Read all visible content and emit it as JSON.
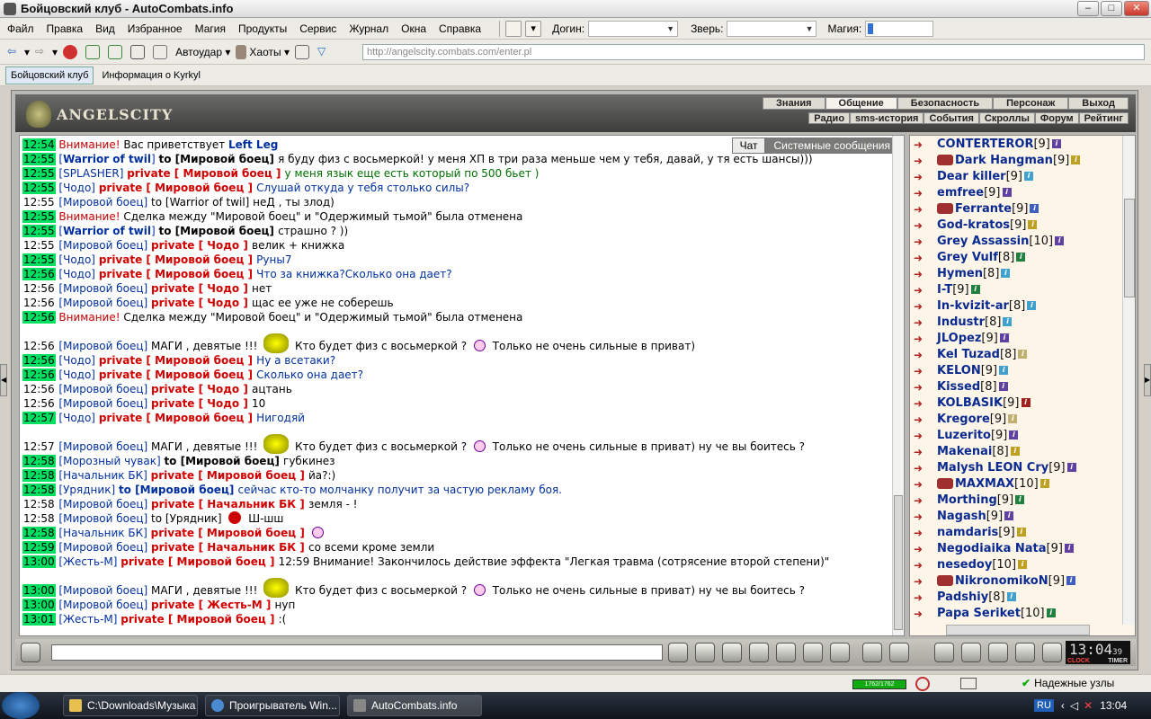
{
  "window": {
    "title": "Бойцовский клуб - AutoCombats.info",
    "btn_min": "–",
    "btn_max": "□",
    "btn_close": "✕"
  },
  "menu": {
    "items": [
      "Файл",
      "Правка",
      "Вид",
      "Избранное",
      "Магия",
      "Продукты",
      "Сервис",
      "Журнал",
      "Окна",
      "Справка"
    ],
    "login_label": "Догин:",
    "beast_label": "Зверь:",
    "magic_label": "Магия:"
  },
  "nav": {
    "autoudar": "Автоудар",
    "haoty": "Хаоты",
    "url": "http://angelscity.combats.com/enter.pl"
  },
  "tabs": [
    "Бойцовский клуб",
    "Информация о Kyrkyl"
  ],
  "game": {
    "logo": "ANGELSCITY",
    "topnav": [
      "Знания",
      "Общение",
      "Безопасность",
      "Персонаж",
      "Выход"
    ],
    "subnav": [
      "Радио",
      "sms-история",
      "События",
      "Скроллы",
      "Форум",
      "Рейтинг"
    ]
  },
  "chat": {
    "tabs": [
      "Чат",
      "Системные сообщения"
    ],
    "lines": [
      {
        "t": "12:54",
        "hl": true,
        "parts": [
          {
            "c": "alert",
            "x": "Внимание! "
          },
          {
            "c": "",
            "x": "Вас приветствует "
          },
          {
            "c": "nick bold",
            "x": "Left Leg"
          }
        ]
      },
      {
        "t": "12:55",
        "hl": true,
        "parts": [
          {
            "c": "nick",
            "x": "["
          },
          {
            "c": "nick bold",
            "x": "Warrior of twil"
          },
          {
            "c": "nick",
            "x": "] "
          },
          {
            "c": "bold",
            "x": "to [Мировой боец] "
          },
          {
            "c": "",
            "x": "я буду физ с восьмеркой! у меня ХП в три раза меньше чем у тебя, давай, у тя есть шансы)))"
          }
        ]
      },
      {
        "t": "12:55",
        "hl": true,
        "parts": [
          {
            "c": "nick",
            "x": "[SPLASHER] "
          },
          {
            "c": "priv",
            "x": "private [ Мировой боец ] "
          },
          {
            "c": "msggreen",
            "x": "у меня язык еще есть который по 500 бьет )"
          }
        ]
      },
      {
        "t": "12:55",
        "hl": true,
        "parts": [
          {
            "c": "nick",
            "x": "[Чодо] "
          },
          {
            "c": "priv",
            "x": "private [ Мировой боец ] "
          },
          {
            "c": "msgblue",
            "x": "Слушай откуда у тебя столько силы?"
          }
        ]
      },
      {
        "t": "12:55",
        "hl": false,
        "parts": [
          {
            "c": "nick",
            "x": "[Мировой боец] "
          },
          {
            "c": "",
            "x": "to [Warrior of twil] неД , ты злод)"
          }
        ]
      },
      {
        "t": "12:55",
        "hl": true,
        "parts": [
          {
            "c": "alert",
            "x": "Внимание! "
          },
          {
            "c": "",
            "x": "Сделка между \"Мировой боец\" и \"Одержимый тьмой\" была отменена"
          }
        ]
      },
      {
        "t": "12:55",
        "hl": true,
        "parts": [
          {
            "c": "nick",
            "x": "["
          },
          {
            "c": "nick bold",
            "x": "Warrior of twil"
          },
          {
            "c": "nick",
            "x": "] "
          },
          {
            "c": "bold",
            "x": "to [Мировой боец] "
          },
          {
            "c": "",
            "x": "страшно ? ))"
          }
        ]
      },
      {
        "t": "12:55",
        "hl": false,
        "parts": [
          {
            "c": "nick",
            "x": "[Мировой боец] "
          },
          {
            "c": "priv",
            "x": "private [ Чодо ] "
          },
          {
            "c": "",
            "x": "велик + книжка"
          }
        ]
      },
      {
        "t": "12:55",
        "hl": true,
        "parts": [
          {
            "c": "nick",
            "x": "[Чодо] "
          },
          {
            "c": "priv",
            "x": "private [ Мировой боец ] "
          },
          {
            "c": "msgblue",
            "x": "Руны7"
          }
        ]
      },
      {
        "t": "12:56",
        "hl": true,
        "parts": [
          {
            "c": "nick",
            "x": "[Чодо] "
          },
          {
            "c": "priv",
            "x": "private [ Мировой боец ] "
          },
          {
            "c": "msgblue",
            "x": "Что за книжка?Сколько она дает?"
          }
        ]
      },
      {
        "t": "12:56",
        "hl": false,
        "parts": [
          {
            "c": "nick",
            "x": "[Мировой боец] "
          },
          {
            "c": "priv",
            "x": "private [ Чодо ] "
          },
          {
            "c": "",
            "x": "нет"
          }
        ]
      },
      {
        "t": "12:56",
        "hl": false,
        "parts": [
          {
            "c": "nick",
            "x": "[Мировой боец] "
          },
          {
            "c": "priv",
            "x": "private [ Чодо ] "
          },
          {
            "c": "",
            "x": "щас ее уже не соберешь"
          }
        ]
      },
      {
        "t": "12:56",
        "hl": true,
        "parts": [
          {
            "c": "alert",
            "x": "Внимание! "
          },
          {
            "c": "",
            "x": "Сделка между \"Мировой боец\" и \"Одержимый тьмой\" была отменена"
          }
        ]
      },
      {
        "t": "12:56",
        "hl": false,
        "gap": true,
        "parts": [
          {
            "c": "nick",
            "x": "[Мировой боец] "
          },
          {
            "c": "",
            "x": "МАГИ , девятые !!! "
          },
          {
            "c": "mage",
            "x": ""
          },
          {
            "c": "",
            "x": " Кто будет физ с восьмеркой ? "
          },
          {
            "c": "smile",
            "x": ""
          },
          {
            "c": "",
            "x": " Только не очень сильные в приват)"
          }
        ]
      },
      {
        "t": "12:56",
        "hl": true,
        "parts": [
          {
            "c": "nick",
            "x": "[Чодо] "
          },
          {
            "c": "priv",
            "x": "private [ Мировой боец ] "
          },
          {
            "c": "msgblue",
            "x": "Ну а всетаки?"
          }
        ]
      },
      {
        "t": "12:56",
        "hl": true,
        "parts": [
          {
            "c": "nick",
            "x": "[Чодо] "
          },
          {
            "c": "priv",
            "x": "private [ Мировой боец ] "
          },
          {
            "c": "msgblue",
            "x": "Сколько она дает?"
          }
        ]
      },
      {
        "t": "12:56",
        "hl": false,
        "parts": [
          {
            "c": "nick",
            "x": "[Мировой боец] "
          },
          {
            "c": "priv",
            "x": "private [ Чодо ] "
          },
          {
            "c": "",
            "x": "ацтань"
          }
        ]
      },
      {
        "t": "12:56",
        "hl": false,
        "parts": [
          {
            "c": "nick",
            "x": "[Мировой боец] "
          },
          {
            "c": "priv",
            "x": "private [ Чодо ] "
          },
          {
            "c": "",
            "x": "10"
          }
        ]
      },
      {
        "t": "12:57",
        "hl": true,
        "parts": [
          {
            "c": "nick",
            "x": "[Чодо] "
          },
          {
            "c": "priv",
            "x": "private [ Мировой боец ] "
          },
          {
            "c": "msgblue",
            "x": "Нигодяй"
          }
        ]
      },
      {
        "t": "12:57",
        "hl": false,
        "gap": true,
        "parts": [
          {
            "c": "nick",
            "x": "[Мировой боец] "
          },
          {
            "c": "",
            "x": "МАГИ , девятые !!! "
          },
          {
            "c": "mage",
            "x": ""
          },
          {
            "c": "",
            "x": " Кто будет физ с восьмеркой ? "
          },
          {
            "c": "smile",
            "x": ""
          },
          {
            "c": "",
            "x": " Только не очень сильные в приват) ну че вы боитесь ?"
          }
        ]
      },
      {
        "t": "12:58",
        "hl": true,
        "parts": [
          {
            "c": "nick",
            "x": "[Морозный чувак] "
          },
          {
            "c": "bold",
            "x": "to [Мировой боец] "
          },
          {
            "c": "",
            "x": "губкинез"
          }
        ]
      },
      {
        "t": "12:58",
        "hl": true,
        "parts": [
          {
            "c": "nick",
            "x": "[Начальник БК] "
          },
          {
            "c": "priv",
            "x": "private [ Мировой боец ] "
          },
          {
            "c": "",
            "x": "йа?:)"
          }
        ]
      },
      {
        "t": "12:58",
        "hl": true,
        "parts": [
          {
            "c": "nick",
            "x": "[Урядник] "
          },
          {
            "c": "nick bold",
            "x": "to [Мировой боец] "
          },
          {
            "c": "msgblue",
            "x": "сейчас кто-то молчанку получит за частую рекламу боя."
          }
        ]
      },
      {
        "t": "12:58",
        "hl": false,
        "parts": [
          {
            "c": "nick",
            "x": "[Мировой боец] "
          },
          {
            "c": "priv",
            "x": "private [ Начальник БК ] "
          },
          {
            "c": "",
            "x": "земля - !"
          }
        ]
      },
      {
        "t": "12:58",
        "hl": false,
        "parts": [
          {
            "c": "nick",
            "x": "[Мировой боец] "
          },
          {
            "c": "",
            "x": "to [Урядник] "
          },
          {
            "c": "redsmile",
            "x": ""
          },
          {
            "c": "",
            "x": " Ш-шш"
          }
        ]
      },
      {
        "t": "12:58",
        "hl": true,
        "parts": [
          {
            "c": "nick",
            "x": "[Начальник БК] "
          },
          {
            "c": "priv",
            "x": "private [ Мировой боец ] "
          },
          {
            "c": "smile",
            "x": ""
          }
        ]
      },
      {
        "t": "12:59",
        "hl": true,
        "parts": [
          {
            "c": "nick",
            "x": "[Мировой боец] "
          },
          {
            "c": "priv",
            "x": "private [ Начальник БК ] "
          },
          {
            "c": "",
            "x": "со всеми кроме земли"
          }
        ]
      },
      {
        "t": "13:00",
        "hl": true,
        "wrap": true,
        "parts": [
          {
            "c": "nick",
            "x": "[Жесть-М] "
          },
          {
            "c": "priv",
            "x": "private [ Мировой боец ] "
          },
          {
            "c": "",
            "x": "12:59 Внимание! Закончилось действие эффекта \"Легкая травма (сотрясение второй степени)\""
          }
        ]
      },
      {
        "t": "13:00",
        "hl": true,
        "gap": true,
        "parts": [
          {
            "c": "nick",
            "x": "[Мировой боец] "
          },
          {
            "c": "",
            "x": "МАГИ , девятые !!! "
          },
          {
            "c": "mage",
            "x": ""
          },
          {
            "c": "",
            "x": " Кто будет физ с восьмеркой ? "
          },
          {
            "c": "smile",
            "x": ""
          },
          {
            "c": "",
            "x": " Только не очень сильные в приват) ну че вы боитесь ?"
          }
        ]
      },
      {
        "t": "13:00",
        "hl": true,
        "parts": [
          {
            "c": "nick",
            "x": "[Мировой боец] "
          },
          {
            "c": "priv",
            "x": "private [ Жесть-М ] "
          },
          {
            "c": "",
            "x": "нуп"
          }
        ]
      },
      {
        "t": "13:01",
        "hl": true,
        "parts": [
          {
            "c": "nick",
            "x": "[Жесть-М] "
          },
          {
            "c": "priv",
            "x": "private [ Мировой боец ] "
          },
          {
            "c": "",
            "x": ":("
          }
        ]
      }
    ]
  },
  "users": [
    {
      "name": "CONTERTEROR",
      "lvl": "[9]",
      "clan": false,
      "ic": "#6040a0"
    },
    {
      "name": "Dark Hangman",
      "lvl": "[9]",
      "clan": true,
      "ic": "#c0a020"
    },
    {
      "name": "Dear killer",
      "lvl": "[9]",
      "clan": false,
      "ic": "#40a0d0"
    },
    {
      "name": "emfree",
      "lvl": "[9]",
      "clan": false,
      "ic": "#6040a0"
    },
    {
      "name": "Ferrante",
      "lvl": "[9]",
      "clan": true,
      "ic": "#4060c0"
    },
    {
      "name": "God-kratos",
      "lvl": "[9]",
      "clan": false,
      "ic": "#c0a020"
    },
    {
      "name": "Grey Assassin",
      "lvl": "[10]",
      "clan": false,
      "ic": "#6040a0"
    },
    {
      "name": "Grey Vulf",
      "lvl": "[8]",
      "clan": false,
      "ic": "#208040"
    },
    {
      "name": "Hymen",
      "lvl": "[8]",
      "clan": false,
      "ic": "#40a0d0"
    },
    {
      "name": "I-T",
      "lvl": "[9]",
      "clan": false,
      "ic": "#208040"
    },
    {
      "name": "In-kvizit-ar",
      "lvl": "[8]",
      "clan": false,
      "ic": "#40a0d0"
    },
    {
      "name": "Industr",
      "lvl": "[8]",
      "clan": false,
      "ic": "#40a0d0"
    },
    {
      "name": "JLOpez",
      "lvl": "[9]",
      "clan": false,
      "ic": "#6040a0"
    },
    {
      "name": "Kel Tuzad",
      "lvl": "[8]",
      "clan": false,
      "ic": "#c0b070"
    },
    {
      "name": "KELON",
      "lvl": "[9]",
      "clan": false,
      "ic": "#40a0d0"
    },
    {
      "name": "Kissed",
      "lvl": "[8]",
      "clan": false,
      "ic": "#6040a0"
    },
    {
      "name": "KOLBASIK",
      "lvl": "[9]",
      "clan": false,
      "ic": "#a02020"
    },
    {
      "name": "Kregore",
      "lvl": "[9]",
      "clan": false,
      "ic": "#c0b070"
    },
    {
      "name": "Luzerito",
      "lvl": "[9]",
      "clan": false,
      "ic": "#6040a0"
    },
    {
      "name": "Makenai",
      "lvl": "[8]",
      "clan": false,
      "ic": "#c0a020"
    },
    {
      "name": "Malysh LEON Cry",
      "lvl": "[9]",
      "clan": false,
      "ic": "#6040a0"
    },
    {
      "name": "MAXMAX",
      "lvl": "[10]",
      "clan": true,
      "ic": "#c0a020"
    },
    {
      "name": "Morthing",
      "lvl": "[9]",
      "clan": false,
      "ic": "#208040"
    },
    {
      "name": "Nagash",
      "lvl": "[9]",
      "clan": false,
      "ic": "#6040a0"
    },
    {
      "name": "namdaris",
      "lvl": "[9]",
      "clan": false,
      "ic": "#c0a020"
    },
    {
      "name": "Negodiaika Nata",
      "lvl": "[9]",
      "clan": false,
      "ic": "#6040a0"
    },
    {
      "name": "nesedoy",
      "lvl": "[10]",
      "clan": false,
      "ic": "#c0a020"
    },
    {
      "name": "NikronomikoN",
      "lvl": "[9]",
      "clan": true,
      "ic": "#4060c0"
    },
    {
      "name": "Padshiy",
      "lvl": "[8]",
      "clan": false,
      "ic": "#40a0d0"
    },
    {
      "name": "Papa Seriket",
      "lvl": "[10]",
      "clan": false,
      "ic": "#208040"
    }
  ],
  "clock": {
    "time": "13:04",
    "sec": "39",
    "clock_label": "CLOCK",
    "timer_label": "TIMER"
  },
  "status": {
    "hp": "1762/1762",
    "secure": "Надежные узлы"
  },
  "taskbar": {
    "items": [
      "C:\\Downloads\\Музыка",
      "Проигрыватель Win...",
      "AutoCombats.info"
    ],
    "lang": "RU",
    "time": "13:04"
  }
}
